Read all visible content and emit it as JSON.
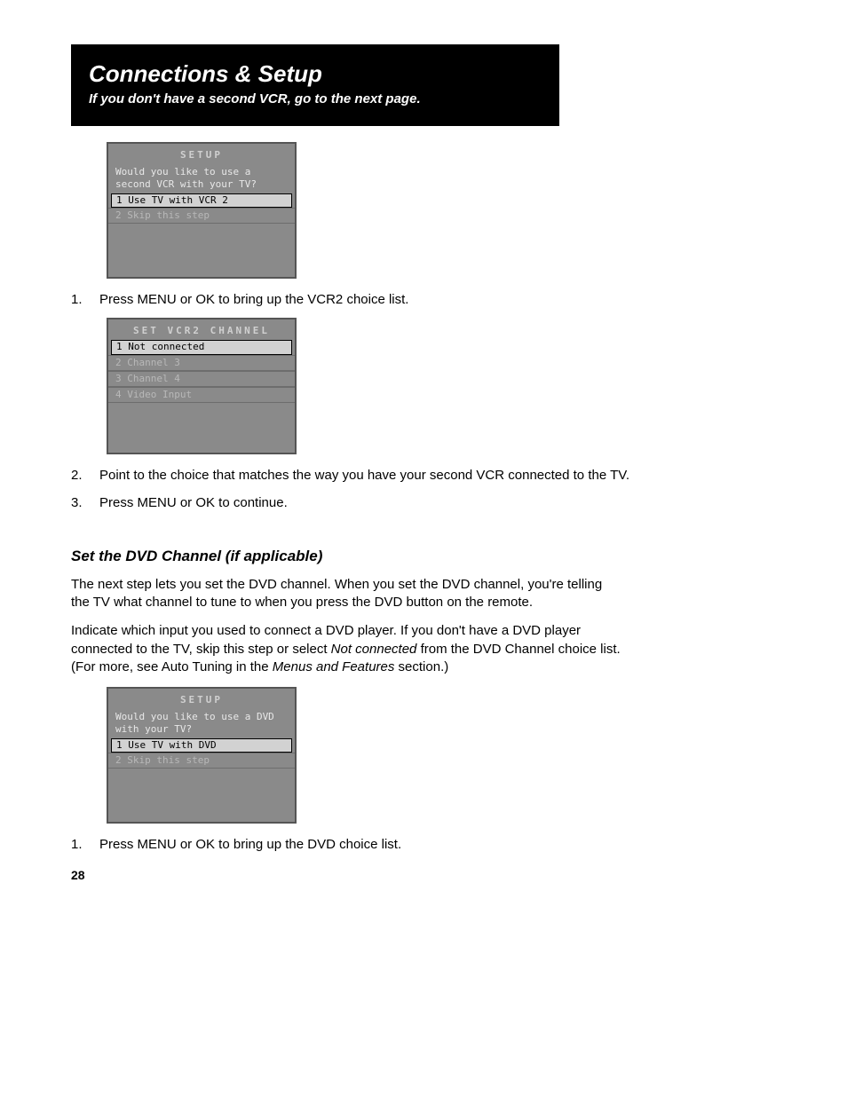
{
  "header": {
    "title": "Connections & Setup",
    "subtitle": "If you don't have a second VCR, go to the next page."
  },
  "screen1": {
    "title": "SETUP",
    "prompt": "Would you like to use a second VCR with your TV?",
    "opt1": "1 Use TV with VCR 2",
    "opt2": "2 Skip this step"
  },
  "step1_1": "1.",
  "step1_1_text": "Press MENU or OK to bring up the VCR2 choice list.",
  "screen2": {
    "title": "SET VCR2 CHANNEL",
    "opt1": "1 Not connected",
    "opt2": "2 Channel 3",
    "opt3": "3 Channel 4",
    "opt4": "4 Video Input"
  },
  "step1_2": "2.",
  "step1_2_text": "Point to the choice that matches the way you have your second VCR connected to the TV.",
  "step1_3": "3.",
  "step1_3_text": "Press MENU or OK to continue.",
  "section_heading": "Set the DVD Channel (if applicable)",
  "para1": "The next step lets you set the DVD channel. When you set the DVD channel, you're telling the TV what channel to tune to when you press the DVD button on the remote.",
  "para2_a": "Indicate which input you used to connect a DVD player. If you don't have a DVD player connected to the TV, skip this step or select ",
  "para2_b": "Not connected",
  "para2_c": " from the DVD Channel choice list. (For more, see Auto Tuning in the ",
  "para2_d": "Menus and Features",
  "para2_e": " section.)",
  "screen3": {
    "title": "SETUP",
    "prompt": "Would you like to use a DVD with your TV?",
    "opt1": "1 Use TV with DVD",
    "opt2": "2 Skip this step"
  },
  "step2_1": "1.",
  "step2_1_text": "Press MENU or OK to bring up the DVD choice list.",
  "page_number": "28"
}
